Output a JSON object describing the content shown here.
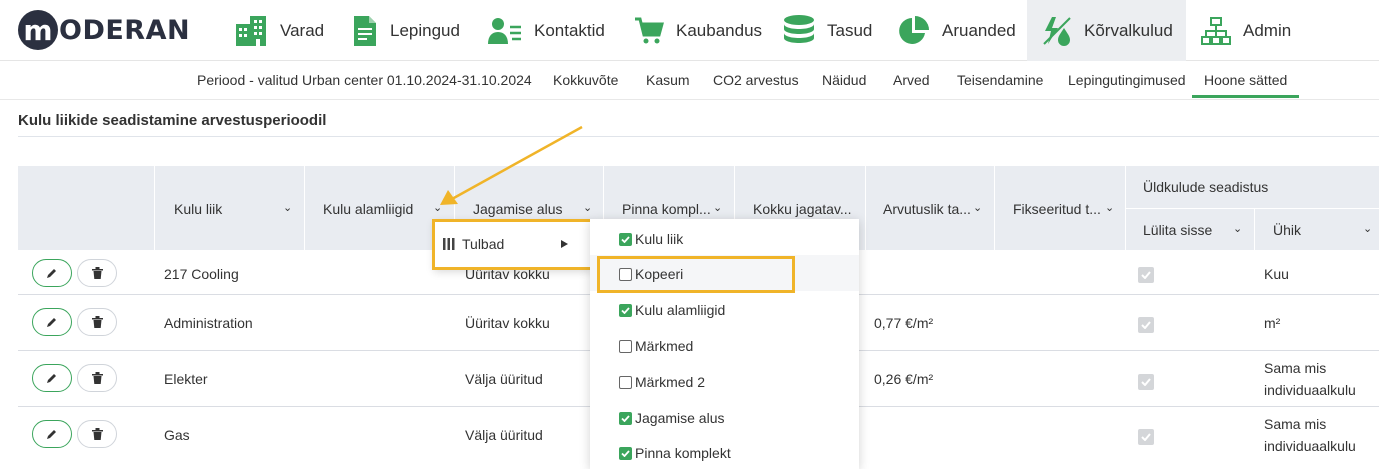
{
  "logo": {
    "initial": "m",
    "rest": "ODERAN"
  },
  "nav": [
    {
      "label": "Varad",
      "icon": "building-icon"
    },
    {
      "label": "Lepingud",
      "icon": "document-icon"
    },
    {
      "label": "Kontaktid",
      "icon": "contacts-icon"
    },
    {
      "label": "Kaubandus",
      "icon": "cart-icon"
    },
    {
      "label": "Tasud",
      "icon": "coins-icon"
    },
    {
      "label": "Aruanded",
      "icon": "pie-chart-icon"
    },
    {
      "label": "Kõrvalkulud",
      "icon": "utilities-icon"
    },
    {
      "label": "Admin",
      "icon": "org-chart-icon"
    }
  ],
  "subnav": {
    "period": "Periood - valitud Urban center 01.10.2024-31.10.2024",
    "items": [
      "Kokkuvõte",
      "Kasum",
      "CO2 arvestus",
      "Näidud",
      "Arved",
      "Teisendamine",
      "Lepingutingimused",
      "Hoone sätted"
    ]
  },
  "page_title": "Kulu liikide seadistamine arvestusperioodil",
  "table": {
    "columns": [
      "Kulu liik",
      "Kulu alamliigid",
      "Jagamise alus",
      "Pinna kompl...",
      "Kokku jagatav...",
      "Arvutuslik ta...",
      "Fikseeritud t..."
    ],
    "group_header": "Üldkulude seadistus",
    "group_columns": [
      "Lülita sisse",
      "Ühik"
    ],
    "rows": [
      {
        "kulu_liik": "217 Cooling",
        "jagamise_alus": "Üüritav kokku",
        "arvutuslik": "",
        "unit_line1": "Kuu",
        "unit_line2": ""
      },
      {
        "kulu_liik": "Administration",
        "jagamise_alus": "Üüritav kokku",
        "arvutuslik": "0,77 €/m²",
        "unit_line1": "m²",
        "unit_line2": ""
      },
      {
        "kulu_liik": "Elekter",
        "jagamise_alus": "Välja üüritud",
        "arvutuslik": "0,26 €/m²",
        "unit_line1": "Sama mis",
        "unit_line2": "individuaalkulu"
      },
      {
        "kulu_liik": "Gas",
        "jagamise_alus": "Välja üüritud",
        "arvutuslik": "",
        "unit_line1": "Sama mis",
        "unit_line2": "individuaalkulu"
      }
    ]
  },
  "column_menu": {
    "label": "Tulbad"
  },
  "columns_menu": {
    "items": [
      {
        "label": "Kulu liik",
        "checked": true
      },
      {
        "label": "Kopeeri",
        "checked": false
      },
      {
        "label": "Kulu alamliigid",
        "checked": true
      },
      {
        "label": "Märkmed",
        "checked": false
      },
      {
        "label": "Märkmed 2",
        "checked": false
      },
      {
        "label": "Jagamise alus",
        "checked": true
      },
      {
        "label": "Pinna komplekt",
        "checked": true
      }
    ]
  },
  "colors": {
    "accent": "#3ba55c",
    "highlight": "#f0b429",
    "header_bg": "#e9ecf1"
  }
}
